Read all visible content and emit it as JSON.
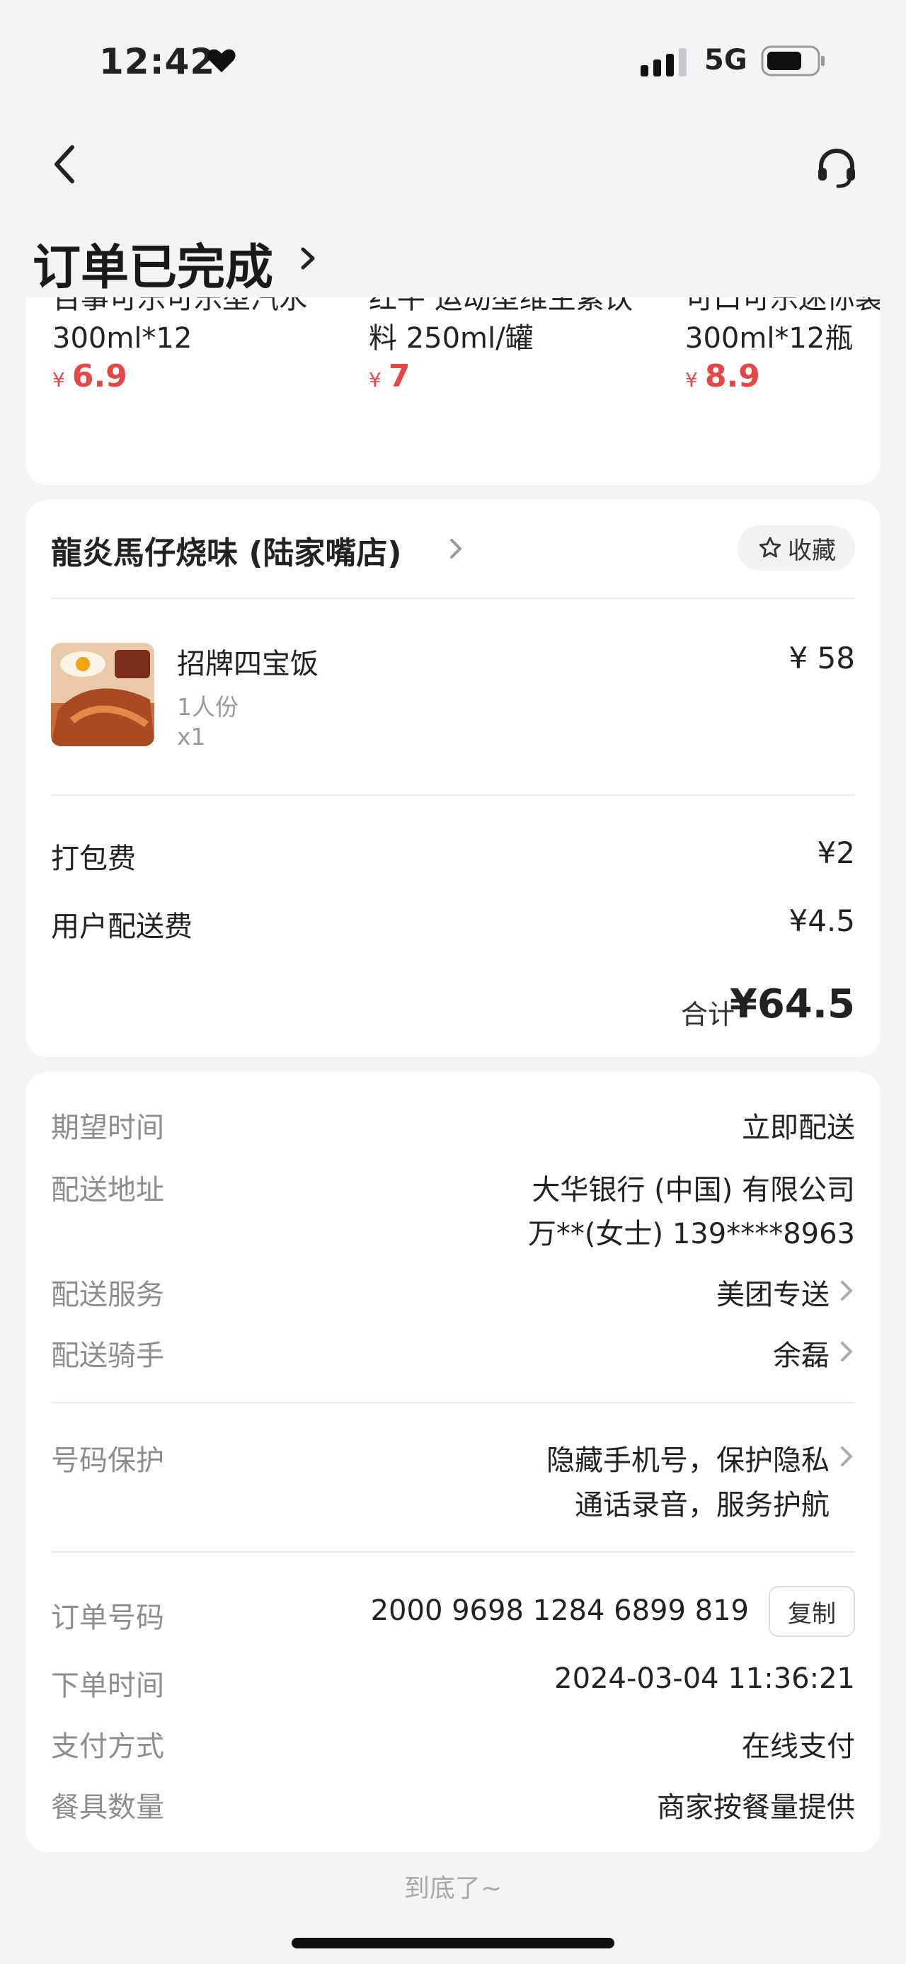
{
  "status_bar": {
    "time": "12:42",
    "network": "5G"
  },
  "header": {
    "title": "订单已完成"
  },
  "recommendations": [
    {
      "name_line1": "百事可乐可乐型汽水",
      "name_line2": "300ml*12",
      "currency": "¥",
      "price": "6.9"
    },
    {
      "name_line1": "红牛 运动型维生素饮",
      "name_line2": "料 250ml/罐",
      "currency": "¥",
      "price": "7"
    },
    {
      "name_line1": "可口可乐迷你装",
      "name_line2": "300ml*12瓶",
      "currency": "¥",
      "price": "8.9"
    }
  ],
  "store": {
    "name": "龍炎馬仔烧味 (陆家嘴店)",
    "favorite_label": "收藏",
    "item": {
      "name": "招牌四宝饭",
      "spec": "1人份",
      "qty": "x1",
      "price": "¥ 58"
    },
    "fees": [
      {
        "label": "打包费",
        "value": "¥2"
      },
      {
        "label": "用户配送费",
        "value": "¥4.5"
      }
    ],
    "total_label": "合计",
    "total_value": "¥64.5"
  },
  "delivery": {
    "expected_time": {
      "label": "期望时间",
      "value": "立即配送"
    },
    "address": {
      "label": "配送地址",
      "line1": "大华银行 (中国) 有限公司",
      "line2": "万**(女士) 139****8963"
    },
    "service": {
      "label": "配送服务",
      "value": "美团专送"
    },
    "rider": {
      "label": "配送骑手",
      "value": "余磊"
    },
    "privacy": {
      "label": "号码保护",
      "line1": "隐藏手机号，保护隐私",
      "line2": "通话录音，服务护航"
    }
  },
  "order": {
    "number": {
      "label": "订单号码",
      "value": "2000 9698 1284 6899 819",
      "copy_label": "复制"
    },
    "time": {
      "label": "下单时间",
      "value": "2024-03-04 11:36:21"
    },
    "payment": {
      "label": "支付方式",
      "value": "在线支付"
    },
    "utensils": {
      "label": "餐具数量",
      "value": "商家按餐量提供"
    }
  },
  "footer": {
    "end_tip": "到底了~"
  },
  "colors": {
    "price_red": "#e84545",
    "background": "#f4f4f6",
    "label_gray": "#8d8d8d"
  }
}
